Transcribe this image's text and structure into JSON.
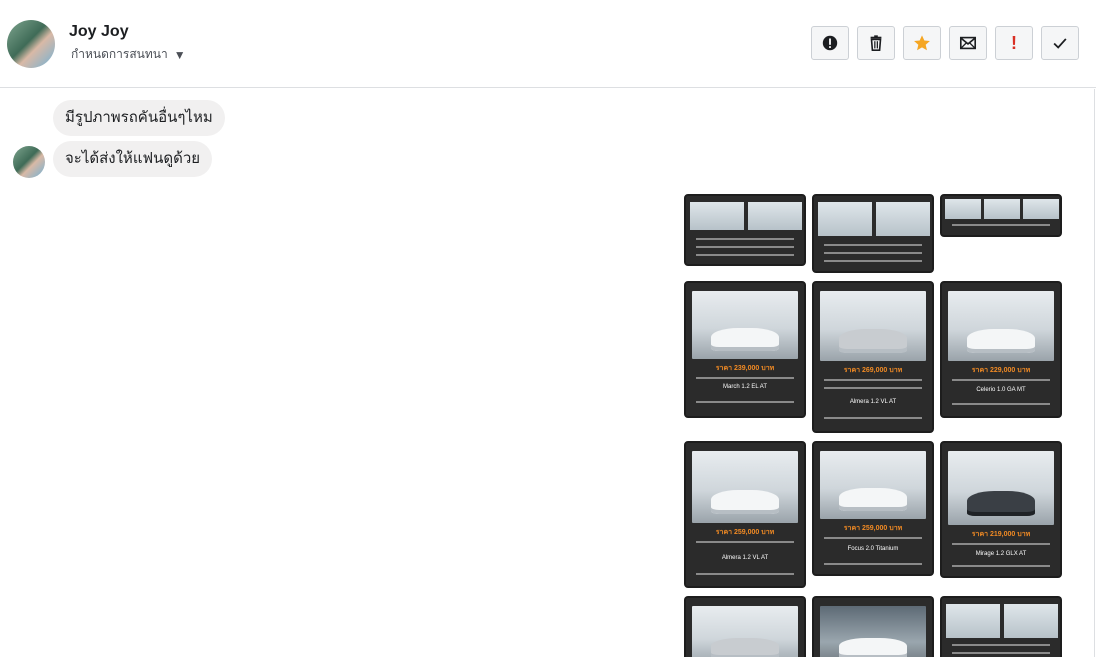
{
  "header": {
    "name": "Joy Joy",
    "status_label": "กำหนดการสนทนา",
    "actions": [
      {
        "icon": "alert-circle-icon",
        "label": "Report"
      },
      {
        "icon": "trash-icon",
        "label": "Delete"
      },
      {
        "icon": "star-icon",
        "label": "Star"
      },
      {
        "icon": "mail-icon",
        "label": "Mark unread"
      },
      {
        "icon": "exclamation-icon",
        "label": "Spam"
      },
      {
        "icon": "check-icon",
        "label": "Done"
      }
    ]
  },
  "messages": [
    {
      "text": "มีรูปภาพรถคันอื่นๆไหม"
    },
    {
      "text": "จะได้ส่งให้แฟนดูด้วย"
    }
  ],
  "images": [
    {
      "price": "ราคา 239,000 บาท",
      "model": "March 1.2 EL AT"
    },
    {
      "price": "ราคา 269,000 บาท",
      "model": "Almera 1.2 VL AT"
    },
    {
      "price": "ราคา 229,000 บาท",
      "model": "Celerio 1.0 GA MT"
    },
    {
      "price": "ราคา 259,000 บาท",
      "model": "Almera 1.2 VL AT"
    },
    {
      "price": "ราคา 259,000 บาท",
      "model": "Focus 2.0 Titanium"
    },
    {
      "price": "ราคา 219,000 บาท",
      "model": "Mirage 1.2 GLX AT"
    }
  ],
  "colors": {
    "star": "#f5a623",
    "spam": "#d93025",
    "bubble": "#f1f0f0",
    "thumb_bg": "#2b2b2b",
    "price": "#f08a24"
  }
}
